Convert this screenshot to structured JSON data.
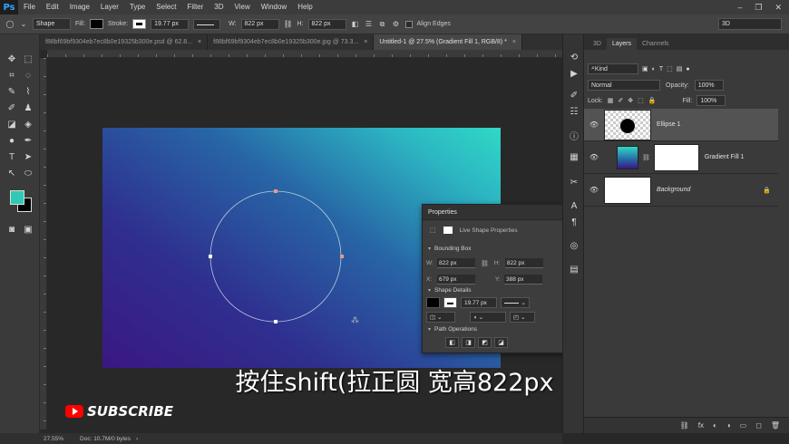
{
  "app": {
    "logo": "Ps"
  },
  "menu": [
    "File",
    "Edit",
    "Image",
    "Layer",
    "Type",
    "Select",
    "Filter",
    "3D",
    "View",
    "Window",
    "Help"
  ],
  "window_controls": [
    "–",
    "❐",
    "✕"
  ],
  "options": {
    "tool_mode": "Shape",
    "fill_label": "Fill:",
    "stroke_label": "Stroke:",
    "stroke_width": "19.77 px",
    "w_label": "W:",
    "w_value": "822 px",
    "h_label": "H:",
    "h_value": "822 px",
    "align_edges": "Align Edges",
    "workspace": "3D"
  },
  "tabs": [
    {
      "label": "f88bf69bf9304eb7ec8b0e19325b300e.psd @ 62.8...",
      "close": "×"
    },
    {
      "label": "f88bf69bf9304eb7ec8b0e19325b300e.jpg @ 73.3...",
      "close": "×"
    },
    {
      "label": "Untitled-1 @ 27.5% (Gradient Fill 1, RGB/8) *",
      "close": "×"
    }
  ],
  "properties": {
    "title": "Properties",
    "subtitle": "Live Shape Properties",
    "bounding_box": "Bounding Box",
    "w_label": "W:",
    "w_value": "822 px",
    "h_label": "H:",
    "h_value": "822 px",
    "x_label": "X:",
    "x_value": "679 px",
    "y_label": "Y:",
    "y_value": "388 px",
    "shape_details": "Shape Details",
    "stroke_width": "19.77 px",
    "path_operations": "Path Operations"
  },
  "layers": {
    "tabs": [
      "3D",
      "Layers",
      "Channels"
    ],
    "kind": "Kind",
    "blend": "Normal",
    "opacity_label": "Opacity:",
    "opacity": "100%",
    "lock_label": "Lock:",
    "fill_label": "Fill:",
    "fill": "100%",
    "items": [
      {
        "name": "Ellipse 1"
      },
      {
        "name": "Gradient Fill 1"
      },
      {
        "name": "Background"
      }
    ],
    "footer_icons": [
      "⛓",
      "fx",
      "◐",
      "◑",
      "▭",
      "◻",
      "🗑"
    ]
  },
  "status": {
    "zoom": "27.55%",
    "doc": "Doc: 10.7M/0 bytes"
  },
  "caption": "按住shift(拉正圆 宽高822px",
  "subscribe": "SUBSCRIBE",
  "colors": {
    "foreground": "#2fc9b5",
    "background": "#000000",
    "accent": "#31a8ff"
  }
}
